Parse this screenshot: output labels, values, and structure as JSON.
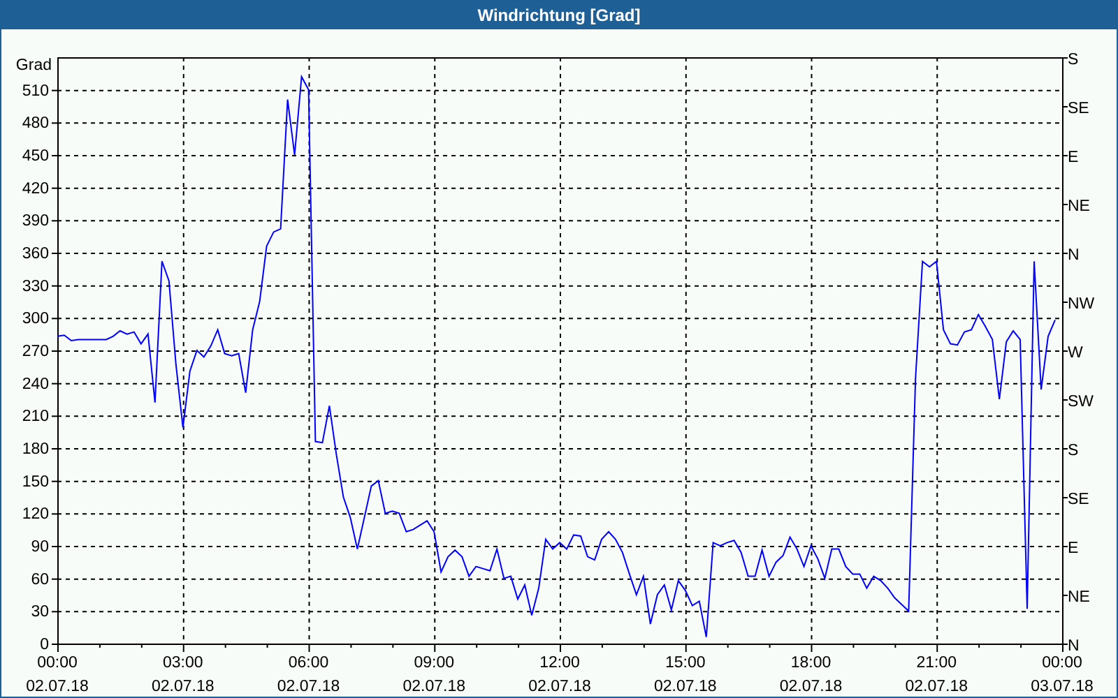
{
  "window": {
    "title": "Windrichtung [Grad]"
  },
  "chart": {
    "chart_data": {
      "type": "line",
      "grid": true,
      "ylabel": "Grad",
      "ylim": [
        0,
        540
      ],
      "categories": [
        "00:00 02.07.18",
        null,
        null,
        null,
        null,
        null,
        null,
        null,
        null,
        null,
        null,
        null,
        null,
        null,
        null,
        null,
        null,
        null,
        "03:00 02.07.18",
        null,
        null,
        null,
        null,
        null,
        null,
        null,
        null,
        null,
        null,
        null,
        null,
        null,
        null,
        null,
        null,
        null,
        "06:00 02.07.18",
        null,
        null,
        null,
        null,
        null,
        null,
        null,
        null,
        null,
        null,
        null,
        null,
        null,
        null,
        null,
        null,
        null,
        "09:00 02.07.18",
        null,
        null,
        null,
        null,
        null,
        null,
        null,
        null,
        null,
        null,
        null,
        null,
        null,
        null,
        null,
        null,
        null,
        "12:00 02.07.18",
        null,
        null,
        null,
        null,
        null,
        null,
        null,
        null,
        null,
        null,
        null,
        null,
        null,
        null,
        null,
        null,
        null,
        "15:00 02.07.18",
        null,
        null,
        null,
        null,
        null,
        null,
        null,
        null,
        null,
        null,
        null,
        null,
        null,
        null,
        null,
        null,
        null,
        "18:00 02.07.18",
        null,
        null,
        null,
        null,
        null,
        null,
        null,
        null,
        null,
        null,
        null,
        null,
        null,
        null,
        null,
        null,
        null,
        "21:00 02.07.18",
        null,
        null,
        null,
        null,
        null,
        null,
        null,
        null,
        null,
        null,
        null,
        null,
        null,
        null,
        null,
        null,
        null,
        "00:00 03.07.18"
      ],
      "yticks": [
        0,
        30,
        60,
        90,
        120,
        150,
        180,
        210,
        240,
        270,
        300,
        330,
        360,
        390,
        420,
        450,
        480,
        510
      ],
      "series": [
        {
          "color": "#0000ff",
          "values": [
            283,
            284,
            279,
            280,
            280,
            280,
            280,
            280,
            283,
            288,
            285,
            287,
            276,
            285,
            222,
            352,
            334,
            257,
            199,
            251,
            270,
            264,
            274,
            289,
            267,
            265,
            267,
            231,
            289,
            315,
            366,
            379,
            382,
            501,
            450,
            522,
            510,
            186,
            185,
            219,
            174,
            135,
            116,
            87,
            116,
            145,
            150,
            120,
            122,
            120,
            103,
            105,
            109,
            113,
            103,
            66,
            80,
            86,
            80,
            62,
            71,
            69,
            67,
            87,
            60,
            62,
            41,
            54,
            26,
            51,
            96,
            87,
            93,
            87,
            100,
            99,
            80,
            77,
            96,
            103,
            96,
            84,
            64,
            45,
            62,
            18,
            45,
            54,
            31,
            58,
            49,
            35,
            39,
            6,
            93,
            90,
            93,
            95,
            84,
            62,
            62,
            86,
            62,
            75,
            81,
            98,
            87,
            71,
            90,
            78,
            60,
            87,
            87,
            71,
            64,
            64,
            51,
            62,
            58,
            51,
            42,
            36,
            30,
            244,
            352,
            347,
            352,
            289,
            276,
            275,
            287,
            289,
            303,
            292,
            280,
            225,
            278,
            288,
            280,
            32,
            352,
            234,
            283,
            298,
            null
          ]
        }
      ]
    },
    "right_ticks": [
      "S",
      "SE",
      "E",
      "NE",
      "N",
      "NW",
      "W",
      "SW",
      "S",
      "SE",
      "E",
      "NE",
      "N"
    ]
  }
}
